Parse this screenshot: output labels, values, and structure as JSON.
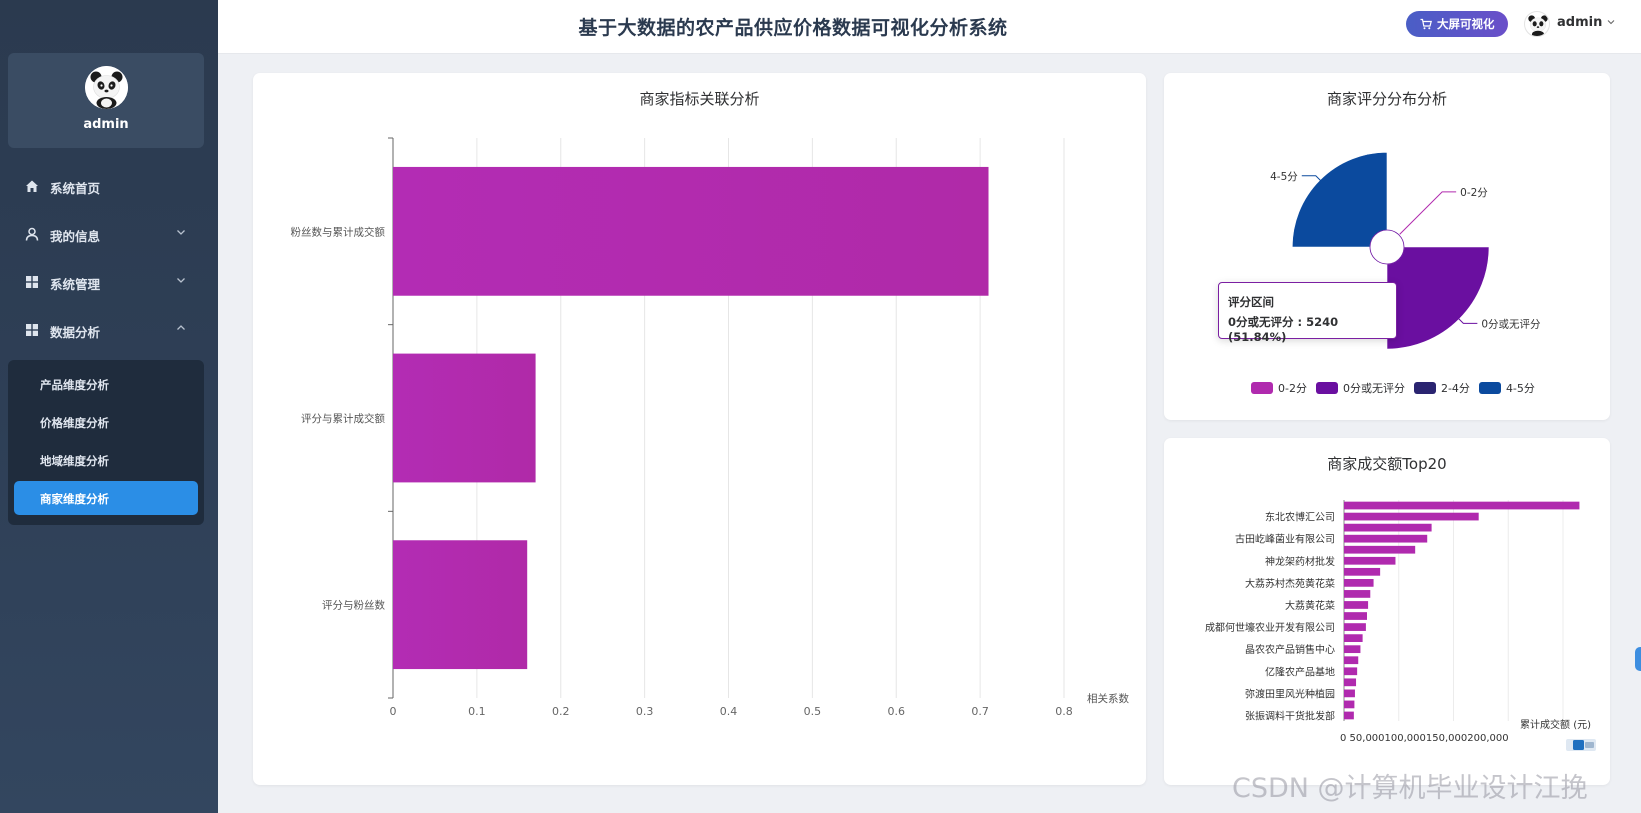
{
  "sidebar": {
    "profile_name": "admin",
    "menu": [
      {
        "label": "系统首页",
        "icon": "home-icon"
      },
      {
        "label": "我的信息",
        "icon": "user-icon",
        "chevron": "down"
      },
      {
        "label": "系统管理",
        "icon": "grid-icon",
        "chevron": "down"
      },
      {
        "label": "数据分析",
        "icon": "grid-icon",
        "chevron": "up"
      }
    ],
    "submenu": [
      {
        "label": "产品维度分析"
      },
      {
        "label": "价格维度分析"
      },
      {
        "label": "地域维度分析"
      },
      {
        "label": "商家维度分析",
        "active": true
      }
    ]
  },
  "header": {
    "title": "基于大数据的农产品供应价格数据可视化分析系统",
    "bigscreen_label": "大屏可视化",
    "username": "admin"
  },
  "colors": {
    "accent": "#2b8ee6",
    "sidebar_bg": "#2e3f56",
    "bar_purple": "#b02aae",
    "pie_blue": "#0b4a9e",
    "pie_violet": "#6a0fa0",
    "pie_navy": "#2a2470"
  },
  "watermark": "CSDN @计算机毕业设计江挽",
  "chart_data": [
    {
      "type": "bar",
      "orientation": "horizontal",
      "title": "商家指标关联分析",
      "categories": [
        "粉丝数与累计成交额",
        "评分与累计成交额",
        "评分与粉丝数"
      ],
      "values": [
        0.71,
        0.17,
        0.16
      ],
      "xlabel": "相关系数",
      "xlim": [
        0,
        0.8
      ],
      "xticks": [
        "0",
        "0.1",
        "0.2",
        "0.3",
        "0.4",
        "0.5",
        "0.6",
        "0.7",
        "0.8"
      ],
      "grid": true
    },
    {
      "type": "pie",
      "subtype": "rose",
      "title": "商家评分分布分析",
      "slices": [
        {
          "name": "0-2分",
          "value": 0.01,
          "color": "#b02aae"
        },
        {
          "name": "0分或无评分",
          "value": 51.84,
          "color": "#6a0fa0"
        },
        {
          "name": "2-4分",
          "value": 0.01,
          "color": "#2a2470"
        },
        {
          "name": "4-5分",
          "value": 48.14,
          "color": "#0b4a9e"
        }
      ],
      "tooltip": {
        "title": "评分区间",
        "text": "0分或无评分 : 5240 (51.84%)"
      },
      "legend": [
        "0-2分",
        "0分或无评分",
        "2-4分",
        "4-5分"
      ],
      "legend_position": "bottom"
    },
    {
      "type": "bar",
      "orientation": "horizontal",
      "title": "商家成交额Top20",
      "categories": [
        "东北农博汇公司",
        "古田屹峰菌业有限公司",
        "神龙架药材批发",
        "大荔苏村杰苑黄花菜",
        "大荔黄花菜",
        "成都何世壕农业开发有限公司",
        "晶农农产品销售中心",
        "亿隆农产品基地",
        "弥渡田里风光种植园",
        "张振调料干货批发部"
      ],
      "values": [
        215000,
        123000,
        80000,
        76000,
        65000,
        47000,
        33000,
        27000,
        24000,
        22000,
        21000,
        20000,
        17000,
        15000,
        13000,
        12000,
        11000,
        10000,
        9500,
        9000
      ],
      "xlabel": "累计成交额 (元)",
      "xticks_text": "0 50,000100,000150,000200,000",
      "xlim": [
        0,
        200000
      ],
      "grid": true
    }
  ]
}
